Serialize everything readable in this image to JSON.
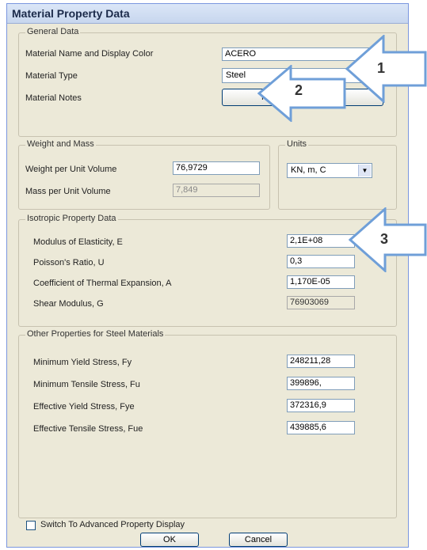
{
  "title": "Material Property Data",
  "general": {
    "legend": "General Data",
    "name_label": "Material Name and Display Color",
    "name_value": "ACERO",
    "type_label": "Material Type",
    "type_value": "Steel",
    "notes_label": "Material Notes",
    "notes_button": "Modify/Show Notes..."
  },
  "weight": {
    "legend": "Weight and Mass",
    "weight_label": "Weight per Unit Volume",
    "weight_value": "76,9729",
    "mass_label": "Mass per Unit Volume",
    "mass_value": "7,849"
  },
  "units": {
    "legend": "Units",
    "value": "KN, m, C"
  },
  "isotropic": {
    "legend": "Isotropic Property Data",
    "e_label": "Modulus of Elasticity,  E",
    "e_value": "2,1E+08",
    "u_label": "Poisson's Ratio,  U",
    "u_value": "0,3",
    "a_label": "Coefficient of Thermal Expansion,  A",
    "a_value": "1,170E-05",
    "g_label": "Shear Modulus,  G",
    "g_value": "76903069"
  },
  "steel": {
    "legend": "Other Properties for Steel Materials",
    "fy_label": "Minimum Yield Stress, Fy",
    "fy_value": "248211,28",
    "fu_label": "Minimum Tensile Stress, Fu",
    "fu_value": "399896,",
    "fye_label": "Effective Yield Stress, Fye",
    "fye_value": "372316,9",
    "fue_label": "Effective Tensile Stress, Fue",
    "fue_value": "439885,6"
  },
  "advanced_label": "Switch To Advanced Property Display",
  "ok_label": "OK",
  "cancel_label": "Cancel",
  "annotations": [
    "1",
    "2",
    "3"
  ],
  "colors": {
    "arrow_stroke": "#6f9fd8",
    "arrow_fill": "#ffffff"
  }
}
